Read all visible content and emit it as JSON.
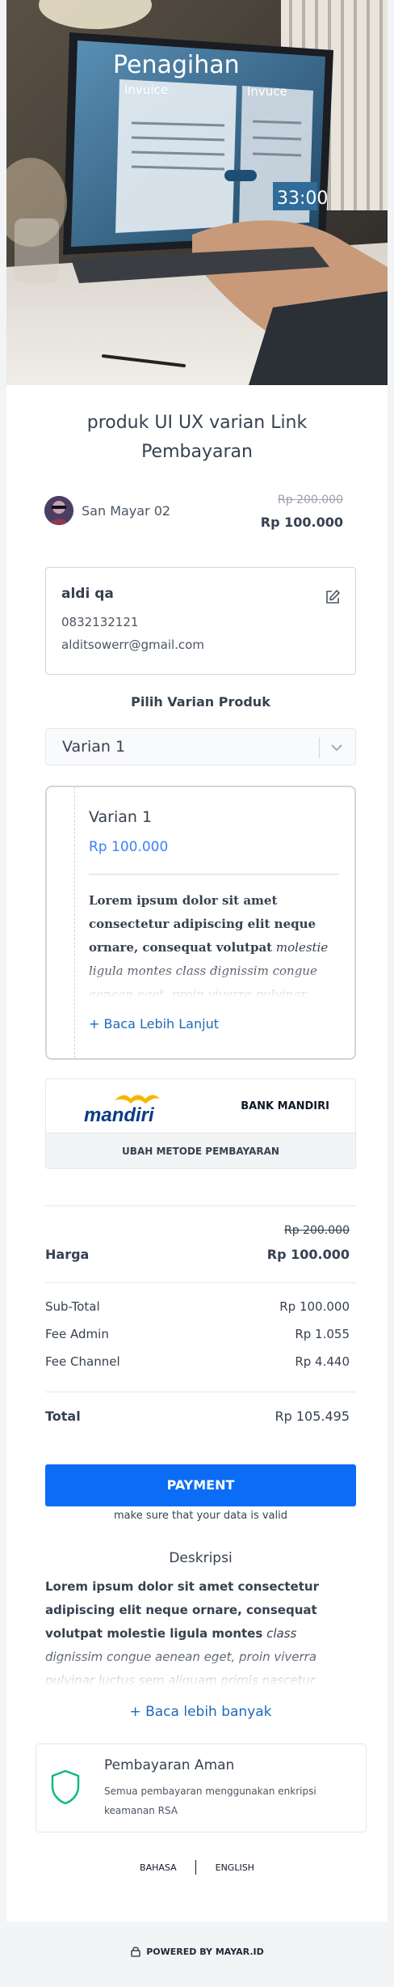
{
  "hero": {
    "screen_title": "Penagihan",
    "panel_left": "Invuice",
    "panel_right": "Invuce",
    "amount": "33:00"
  },
  "product": {
    "title": "produk UI UX varian Link Pembayaran"
  },
  "seller": {
    "name": "San Mayar 02",
    "price_old": "Rp 200.000",
    "price_new": "Rp 100.000"
  },
  "buyer": {
    "name": "aldi qa",
    "phone": "0832132121",
    "email": "alditsowerr@gmail.com"
  },
  "variant_select": {
    "label": "Pilih Varian Produk",
    "selected": "Varian 1"
  },
  "variant_card": {
    "name": "Varian 1",
    "price": "Rp 100.000",
    "desc_bold": "Lorem ipsum dolor sit amet consectetur adipiscing elit neque ornare, consequat volutpat",
    "desc_italic": "molestie ligula montes class dignissim congue aenean eget, proin viverra pulvinar luctus",
    "more": "+ Baca Lebih Lanjut"
  },
  "payment_method": {
    "logo_text": "mandiri",
    "bank": "BANK MANDIRI",
    "change": "UBAH METODE PEMBAYARAN"
  },
  "summary": {
    "price_old": "Rp 200.000",
    "price_label": "Harga",
    "price_value": "Rp 100.000",
    "subtotal_label": "Sub-Total",
    "subtotal_value": "Rp 100.000",
    "fee_admin_label": "Fee Admin",
    "fee_admin_value": "Rp 1.055",
    "fee_channel_label": "Fee Channel",
    "fee_channel_value": "Rp 4.440",
    "total_label": "Total",
    "total_value": "Rp 105.495"
  },
  "pay": {
    "button": "PAYMENT",
    "note": "make sure that your data is valid"
  },
  "description": {
    "title": "Deskripsi",
    "bold": "Lorem ipsum dolor sit amet consectetur adipiscing elit neque ornare, consequat volutpat molestie ligula montes",
    "italic": "class dignissim congue aenean eget, proin viverra pulvinar luctus sem aliquam primis nascetur. Vulputate urna imperdiet magnis vehicula hac",
    "more": "+ Baca lebih banyak"
  },
  "secure": {
    "title": "Pembayaran Aman",
    "text": "Semua pembayaran menggunakan enkripsi keamanan RSA"
  },
  "language": {
    "option1": "BAHASA",
    "option2": "ENGLISH"
  },
  "footer": {
    "powered": "POWERED BY MAYAR.ID"
  },
  "colors": {
    "primary": "#0b6cf5",
    "link": "#1e6ab8",
    "price_accent": "#3b82f6",
    "shield": "#10b981"
  }
}
